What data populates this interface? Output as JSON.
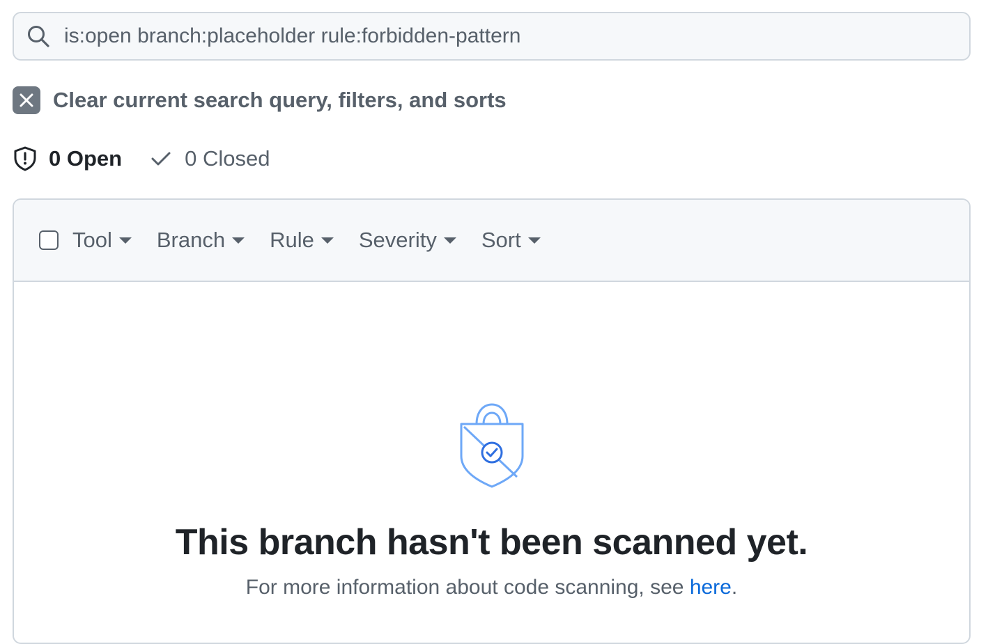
{
  "search": {
    "value": "is:open branch:placeholder rule:forbidden-pattern",
    "icon": "search-icon"
  },
  "clear": {
    "label": "Clear current search query, filters, and sorts",
    "icon": "close-icon"
  },
  "states": {
    "open": {
      "count_label": "0 Open",
      "icon": "shield-alert-icon"
    },
    "closed": {
      "count_label": "0 Closed",
      "icon": "check-icon"
    }
  },
  "toolbar": {
    "filters": [
      {
        "label": "Tool"
      },
      {
        "label": "Branch"
      },
      {
        "label": "Rule"
      },
      {
        "label": "Severity"
      },
      {
        "label": "Sort"
      }
    ]
  },
  "empty_state": {
    "icon": "shield-lock-check-icon",
    "title": "This branch hasn't been scanned yet.",
    "description_prefix": "For more information about code scanning, see ",
    "link_label": "here",
    "description_suffix": "."
  },
  "colors": {
    "link": "#0969da",
    "muted": "#57606a",
    "border": "#d0d7de",
    "canvas_subtle": "#f6f8fa",
    "illustration": "#6ea8f7"
  }
}
